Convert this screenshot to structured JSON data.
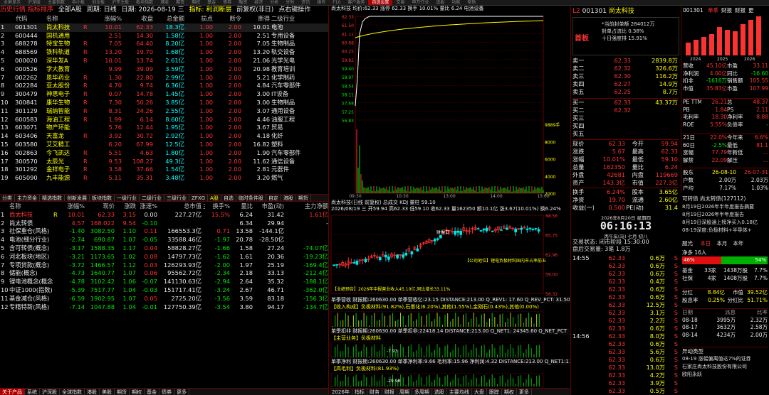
{
  "top_menu": [
    "全屏显示",
    "沪深股",
    "主要指数",
    "中小板",
    "创业板",
    "沪市主板",
    "板块指数",
    "港股",
    "期货",
    "期权",
    "基金",
    "债券",
    "融资",
    "经济",
    "分析",
    "分时",
    "资讯",
    "操作",
    "F10",
    "客户服务",
    "自选设置",
    "交易",
    "申万行业",
    "选股",
    "功能",
    "帮助"
  ],
  "top_menu_active": 20,
  "left_header": {
    "title": "历史行情.指标排序",
    "scope": "全部A股",
    "period": "周期: 日线",
    "date": "日期: 2026-08-19 三",
    "indicator": "指标: 利润断层",
    "extra": "前复权(非日)",
    "op": "点右键操作"
  },
  "table1_columns": [
    "代码",
    "名称",
    "",
    "涨幅%",
    "收盘",
    "总金额",
    "损点",
    "断令",
    "断得",
    "二级行业"
  ],
  "table1_rows": [
    [
      "1",
      "001301",
      "尚太科技",
      "R",
      "10.01",
      "62.33",
      "18.3亿",
      "1.00",
      "2.00",
      "10.01",
      "电池"
    ],
    [
      "2",
      "600444",
      "国机通用",
      "",
      "2.51",
      "14.30",
      "1.58亿",
      "1.00",
      "2.00",
      "2.51",
      "专用设备"
    ],
    [
      "3",
      "688278",
      "特宝生物",
      "R",
      "7.05",
      "64.40",
      "8.20亿",
      "1.00",
      "2.00",
      "7.05",
      "生物制品"
    ],
    [
      "4",
      "688569",
      "铁科轨道",
      "R",
      "13.20",
      "19.70",
      "1.68亿",
      "1.00",
      "2.00",
      "13.20",
      "轨交设备"
    ],
    [
      "5",
      "000020",
      "深华发A",
      "R",
      "10.01",
      "13.74",
      "2.61亿",
      "1.00",
      "2.00",
      "21.06",
      "光学光电"
    ],
    [
      "6",
      "000526",
      "学大教育",
      "",
      "9.99",
      "39.09",
      "3.59亿",
      "1.00",
      "2.00",
      "20.98",
      "教育培训"
    ],
    [
      "7",
      "002262",
      "恩华药业",
      "R",
      "1.30",
      "22.80",
      "2.99亿",
      "1.00",
      "2.00",
      "5.21",
      "化学制药"
    ],
    [
      "8",
      "002284",
      "亚太股份",
      "R",
      "4.70",
      "9.74",
      "6.36亿",
      "1.00",
      "2.00",
      "4.84",
      "汽车零部件"
    ],
    [
      "9",
      "300479",
      "神思电子",
      "R",
      "0.07",
      "14.78",
      "1.45亿",
      "1.00",
      "2.00",
      "3.00",
      "IT设备"
    ],
    [
      "10",
      "300841",
      "康华生物",
      "R",
      "7.30",
      "50.26",
      "3.85亿",
      "1.00",
      "2.00",
      "3.00",
      "生物制品"
    ],
    [
      "11",
      "301129",
      "瑞纳智能",
      "R",
      "8.31",
      "24.26",
      "2.55亿",
      "1.00",
      "2.00",
      "3.07",
      "通用设备"
    ],
    [
      "12",
      "600583",
      "海油工程",
      "R",
      "1.99",
      "6.14",
      "8.60亿",
      "1.00",
      "2.00",
      "4.46",
      "油服工程"
    ],
    [
      "13",
      "603071",
      "物产环能",
      "",
      "5.76",
      "12.44",
      "1.95亿",
      "1.00",
      "2.00",
      "3.67",
      "贸易"
    ],
    [
      "14",
      "603406",
      "天富龙",
      "R",
      "3.92",
      "30.72",
      "2.92亿",
      "1.00",
      "2.00",
      "4.18",
      "化纤"
    ],
    [
      "15",
      "603580",
      "艾艾精工",
      "",
      "6.20",
      "67.99",
      "12.5亿",
      "1.00",
      "2.00",
      "16.82",
      "塑料"
    ],
    [
      "16",
      "002863",
      "今飞凯达",
      "R",
      "5.51",
      "4.63",
      "1.80亿",
      "1.00",
      "2.00",
      "1.90",
      "汽车零部件"
    ],
    [
      "17",
      "300570",
      "太辰光",
      "R",
      "9.53",
      "108.27",
      "49.3亿",
      "1.00",
      "2.00",
      "11.62",
      "通信设备"
    ],
    [
      "18",
      "301292",
      "金祥电子",
      "R",
      "3.58",
      "37.66",
      "1.54亿",
      "1.00",
      "2.00",
      "2.81",
      "元器件"
    ],
    [
      "19",
      "605090",
      "九丰能源",
      "R",
      "5.11",
      "35.31",
      "3.48亿",
      "1.00",
      "2.00",
      "3.20",
      "燃气"
    ]
  ],
  "mid_tabs": [
    "分类",
    "主力资金",
    "精选指数",
    "创新发展",
    "板块指数",
    "一级行业",
    "二级行业",
    "三级行业",
    "ZFXG",
    "A股",
    "自选",
    "临时条件股",
    "自定",
    "港股",
    "期货"
  ],
  "mid_tabs_active": 9,
  "table2_columns": [
    "",
    "名称",
    "",
    "涨幅%",
    "现价",
    "涨跌",
    "涨速%",
    "总市值",
    "主力净额",
    "换手%",
    "量比",
    "市盈(动)",
    "主力净额"
  ],
  "table2_rows": [
    [
      "1",
      "尚太科技",
      "R",
      "10.01",
      "62.33",
      "3.15",
      "0.00",
      "227.27亿",
      "",
      "15.5%",
      "6.24",
      "31.42",
      "1.61亿"
    ],
    [
      "2",
      "尚太转债",
      "",
      "4.57",
      "168.022",
      "9.54",
      "-0.10",
      "",
      "",
      "",
      "6.34",
      "29.94",
      "-",
      "616.5万"
    ],
    [
      "3",
      "社保重仓(风格)",
      "",
      "-1.40",
      "3082.50",
      "1.10",
      "0.11",
      "166553.3亿",
      "",
      "0.71",
      "13.58",
      "-144.1亿"
    ],
    [
      "4",
      "电池(细分行业)",
      "",
      "-2.74",
      "690.87",
      "1.07",
      "-0.05",
      "33588.46亿",
      "",
      "-1.97",
      "20.78",
      "-28.50亿"
    ],
    [
      "5",
      "含可转债(概念)",
      "",
      "-3.17",
      "1588.35",
      "1.17",
      "0.04",
      "58828.27亿",
      "",
      "-1.66",
      "1.58",
      "27.24",
      "-74.07亿"
    ],
    [
      "6",
      "河北板块(地区)",
      "",
      "-3.21",
      "1173.65",
      "1.02",
      "0.08",
      "14797.73亿",
      "",
      "-1.62",
      "1.61",
      "20.36",
      "-19.23亿"
    ],
    [
      "7",
      "专项贷款(概念)",
      "",
      "-3.72",
      "1466.57",
      "1.12",
      "0.03",
      "126293.93亿",
      "",
      "-2.00",
      "1.97",
      "25.19",
      "-169.4亿"
    ],
    [
      "8",
      "储能(概念)",
      "",
      "-4.73",
      "1640.77",
      "1.07",
      "0.06",
      "95562.72亿",
      "",
      "-2.34",
      "2.18",
      "33.13",
      "-212.4亿"
    ],
    [
      "9",
      "锂电池概念(概念)",
      "",
      "-4.78",
      "3102.42",
      "1.06",
      "-0.07",
      "141130.63亿",
      "",
      "-2.94",
      "2.64",
      "35.32",
      "-188.1亿"
    ],
    [
      "10",
      "中证1000(指数)",
      "",
      "-5.39",
      "7517.77",
      "1.04",
      "-0.03",
      "151717.41亿",
      "",
      "-3.24",
      "2.67",
      "46.71",
      "-362.0亿"
    ],
    [
      "11",
      "基金减仓(风格)",
      "",
      "-6.59",
      "1902.95",
      "1.07",
      "0.05",
      "2725.20亿",
      "",
      "-3.56",
      "3.59",
      "83.18",
      "-156.3亿"
    ],
    [
      "12",
      "专精特新(风格)",
      "",
      "-7.14",
      "1047.88",
      "1.04",
      "-0.01",
      "127750.39亿",
      "",
      "-3.54",
      "3.80",
      "94.17",
      "-134.7亿"
    ]
  ],
  "bottom_tabs": [
    "关于产品",
    "系统",
    "沪深股",
    "全球指数",
    "港股",
    "美股",
    "期货",
    "期权",
    "基金",
    "债券",
    "更多"
  ],
  "chart": {
    "intraday_title": "尚太科技 均价:62.33 涨停 62.33 换手 10.01% 量比 6.24 电池设备",
    "intraday_prices": [
      "62.33",
      "61.50",
      "61.11",
      "60.68",
      "60.25",
      "59.82",
      "59.40",
      "58.97",
      "58.54",
      "58.11",
      "57.68",
      "57.25",
      "56.83"
    ],
    "intraday_vols": [
      "9889手",
      "8000",
      "6000",
      "4000",
      "2000"
    ],
    "time_labels": [
      "09:30",
      "10:30",
      "13:00",
      "14:00",
      "15:00"
    ],
    "kline_title": "尚太科技(日线 前复权) 总成交 KDJ 量柱 59.10",
    "kline_info": "2026/08/19 三 开59.94 高62.33 低59.10 收62.33 量162350 额10.1亿 涨3.67(10.01%) 换6.24%",
    "kline_prices": [
      "68.56",
      "65.75",
      "62.96",
      "59.00",
      "56.32"
    ],
    "annot1": "【公司地位】锂电负极材料国内市占率前五",
    "annot2": "【业绩预告】2026年中报营业收入45.10亿,同比增长33.11%",
    "annot_tag": "财报日",
    "sub1_title": "单季营收 财报期:260630.00 单季营收亿:23.15 DISTANCE:213.00 Q_REV1: 17.60 Q_REV_PCT: 31.50",
    "sub1_note": "【收入构成】负极材料(91.82%),石墨化(6.20%),其他(1.55%),金刚石(0.43%),其他(0.00%)",
    "sub2_title": "单季扣非 财报期:260630.00 单季扣非:22418.14 DISTANCE:213.00 Q_NET1: 24345.60 Q_NET_PCT",
    "sub2_note": "【主营业务】负极材料",
    "sub2_val": "-7.93",
    "sub3_title": "单季净利 财报期:260630.00 单季净利率:9.66 毛利率:15.96 净利润:4.32 DISTANCE:213.00 Q_NET1:13.83",
    "sub3_note": "【高毛利】负极材料(81.93%)",
    "sub3_val": "-29.98",
    "sub4_val": "-22.40",
    "sub5_val": "-42.46",
    "bottom_labels": [
      "2026年",
      "指标",
      "财务",
      "财报",
      "周期",
      "多周期",
      "选股",
      "主要均线",
      "大盘",
      "跟踪",
      "期权",
      "更多"
    ]
  },
  "quote": {
    "tag": "L2",
    "code": "001301",
    "name": "尚太科技",
    "board": "首板",
    "info1": "*当前封单额 284012万",
    "info2": "封单占流比 0.38%",
    "info3": "十日强度排 15.91%",
    "sells": [
      [
        "卖一",
        "62.33",
        "2839.8万"
      ],
      [
        "卖二",
        "62.32",
        "326.6万"
      ],
      [
        "卖三",
        "62.30",
        "116.2万"
      ],
      [
        "卖四",
        "62.27",
        "14.9万"
      ],
      [
        "卖五",
        "62.25",
        "8.7万"
      ]
    ],
    "buys": [
      [
        "买一",
        "62.33",
        "43.37万"
      ],
      [
        "买二",
        "62.32",
        "",
        ""
      ],
      [
        "买三",
        "",
        ""
      ],
      [
        "买四",
        "",
        ""
      ],
      [
        "买五",
        "",
        ""
      ]
    ],
    "stats": [
      [
        "现价",
        "62.33",
        "今开",
        "59.94"
      ],
      [
        "涨跌",
        "5.67",
        "最高",
        "62.33"
      ],
      [
        "涨幅",
        "10.01%",
        "最低",
        "59.10"
      ],
      [
        "总量",
        "162350",
        "量比",
        "6.24"
      ],
      [
        "外盘",
        "42681",
        "内盘",
        "119669"
      ],
      [
        "资产",
        "143.3亿",
        "市值",
        "227.3亿"
      ]
    ],
    "stats2": [
      [
        "换手",
        "6.24%",
        "股本",
        "3.65亿"
      ],
      [
        "净资",
        "19.70",
        "流通",
        "2.60亿"
      ],
      [
        "收益(一)",
        "0.500",
        "PE(动)",
        "31.4"
      ]
    ],
    "clock_date": "2026年8月20日 星期四",
    "clock_time": "06:16:13",
    "clock_lunar": "丙午年(马) 七月 初八",
    "trade_status": "交易状态: 闭市阶段 15:30:00",
    "trade_vol": "盘后交易量: 3笔 1.8万",
    "ticks": [
      [
        "14:55",
        "62.33",
        "0.6万",
        "S"
      ],
      [
        "",
        "62.33",
        "0.6万",
        "S"
      ],
      [
        "",
        "62.33",
        "0.6万",
        "S"
      ],
      [
        "",
        "62.33",
        "0.4万",
        "S"
      ],
      [
        "",
        "62.33",
        "0.6万",
        "S"
      ],
      [
        "",
        "62.33",
        "0.6万",
        "S"
      ],
      [
        "",
        "62.33",
        "12.5万",
        "S"
      ],
      [
        "",
        "62.33",
        "3.1万",
        "S"
      ],
      [
        "",
        "62.33",
        "2.2万",
        "S"
      ],
      [
        "",
        "62.33",
        "0.6万",
        "S"
      ],
      [
        "14:56",
        "62.33",
        "8.0万",
        "S"
      ],
      [
        "",
        "62.33",
        "0.6万",
        "S"
      ],
      [
        "",
        "62.33",
        "5.6万",
        "S"
      ],
      [
        "",
        "62.33",
        "0.6万",
        "S"
      ],
      [
        "",
        "62.33",
        "13.0万",
        "S"
      ],
      [
        "",
        "62.33",
        "4.2万",
        "S"
      ],
      [
        "",
        "62.33",
        "3.9万",
        "S"
      ],
      [
        "",
        "62.33",
        "0.5万",
        "S"
      ],
      [
        "",
        "62.33",
        "5.6万",
        "S"
      ],
      [
        "",
        "62.33",
        "5.6万",
        "S"
      ],
      [
        "",
        "62.33",
        "8.3万",
        "S"
      ],
      [
        "",
        "62.33",
        "3.1万",
        "S"
      ],
      [
        "",
        "62.33",
        "0.5万",
        "S"
      ],
      [
        "",
        "62.33",
        "0.5万",
        "S"
      ],
      [
        "14:57",
        "62.33",
        "5.0万",
        "S"
      ],
      [
        "",
        "62.33",
        "5.6万",
        "S"
      ],
      [
        "",
        "62.33",
        "8.1万",
        "S"
      ],
      [
        "15:00",
        "62.33",
        "163.3万",
        "S"
      ],
      [
        "",
        "62.33",
        "4.1万",
        "S"
      ]
    ]
  },
  "fin": {
    "code": "001301",
    "tabs": [
      "单季",
      "财报",
      "财报",
      "更"
    ],
    "years": [
      "2024",
      "2025",
      "2026"
    ],
    "rows": [
      [
        "营收",
        "45.10亿",
        "市盈",
        "33.11"
      ],
      [
        "净利润",
        "4.00亿",
        "同比",
        "-16.60"
      ],
      [
        "扣非",
        "-1616万",
        "销售额",
        "105.55"
      ],
      [
        "市值",
        "35.83亿",
        "市盈",
        "107.99"
      ]
    ],
    "ratios": [
      [
        "PE TTM",
        "26.21",
        "总",
        "48.37"
      ],
      [
        "PB",
        "1.84",
        "PS",
        "2.11"
      ],
      [
        "毛利率",
        "18.30",
        "净利率",
        "8.88"
      ],
      [
        "ROE",
        "5.55%",
        "负债率",
        "-"
      ]
    ],
    "rows2": [
      [
        "21日",
        "22.0%",
        "今年来",
        "6.6%"
      ],
      [
        "60日",
        "-2.5%",
        "最低",
        "81.1"
      ],
      [
        "涨幅",
        "77.79",
        "年新低",
        "..."
      ],
      [
        "解禁",
        "22.09",
        "解压",
        "..."
      ]
    ],
    "holders_head": [
      "股东",
      "26-08-10",
      "26-07-31"
    ],
    "holders": [
      [
        "户数",
        "2.00万",
        "2.03万"
      ],
      [
        "户均",
        "7.17%",
        "1.03%"
      ]
    ],
    "fund_title": "可转债 尚太转债(127112)",
    "notices": [
      "8月19日2026年半年度报告摘要",
      "8月19日2026年半年度报告",
      "8月19日深股通上榜净买入0.18亿",
      "08-19深度:负极材料+半导体+"
    ],
    "rank_title": "服光",
    "rank_tabs": [
      "本日",
      "本月",
      "本年"
    ],
    "rank_labels": [
      "净多",
      "16人"
    ],
    "ratio_bar": [
      "46%",
      "54%"
    ],
    "hold_rows": [
      [
        "基金",
        "33家",
        "1438万股",
        "7.7%"
      ],
      [
        "社保",
        "4家",
        "1408万股",
        "7.7%"
      ]
    ],
    "hold_sum": [
      [
        "分红",
        "8.84亿",
        "市值",
        "39.52亿"
      ],
      [
        "股息率",
        "0.25%",
        "分红比",
        "51.71%"
      ]
    ],
    "div_head": [
      "日期",
      "派息",
      "比率"
    ],
    "divs": [
      [
        "08-18",
        "3995万",
        "2.32万"
      ],
      [
        "08-17",
        "3632万",
        "2.58万"
      ],
      [
        "08-14",
        "4234万",
        "2.00万"
      ]
    ],
    "news_head": "异动类型",
    "news": [
      "08-19 涨幅偏离值达7%的证券",
      "石家庄尚太科技股份有限公司",
      "欧阳永跃"
    ]
  }
}
